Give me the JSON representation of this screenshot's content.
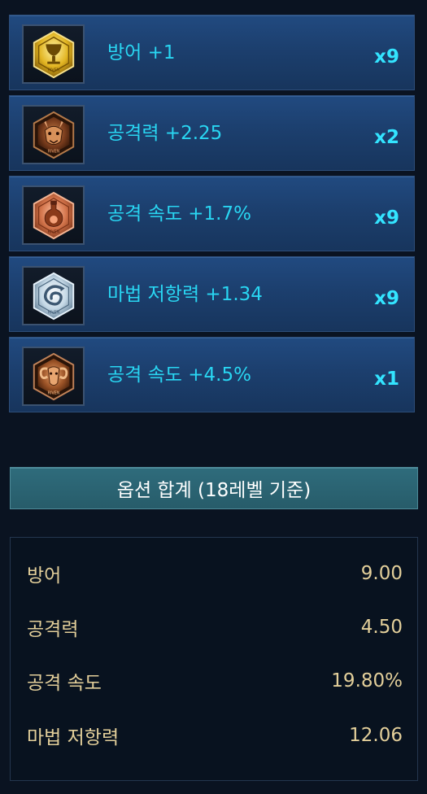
{
  "runes": [
    {
      "name": "방어 +1",
      "count": "x9",
      "icon": "golden-chalice-icon"
    },
    {
      "name": "공격력 +2.25",
      "count": "x2",
      "icon": "dragon-head-icon"
    },
    {
      "name": "공격 속도 +1.7%",
      "count": "x9",
      "icon": "potion-flask-icon"
    },
    {
      "name": "마법 저항력 +1.34",
      "count": "x9",
      "icon": "dragon-coil-icon"
    },
    {
      "name": "공격 속도 +4.5%",
      "count": "x1",
      "icon": "ram-head-icon"
    }
  ],
  "summary": {
    "button_label": "옵션 합계 (18레벨 기준)",
    "stats": [
      {
        "label": "방어",
        "value": "9.00"
      },
      {
        "label": "공격력",
        "value": "4.50"
      },
      {
        "label": "공격 속도",
        "value": "19.80%"
      },
      {
        "label": "마법 저항력",
        "value": "12.06"
      }
    ]
  },
  "colors": {
    "rune_name": "#29d6f2",
    "rune_count": "#33e4ff",
    "stat_text": "#e3cf9a",
    "background": "#0a1321"
  }
}
